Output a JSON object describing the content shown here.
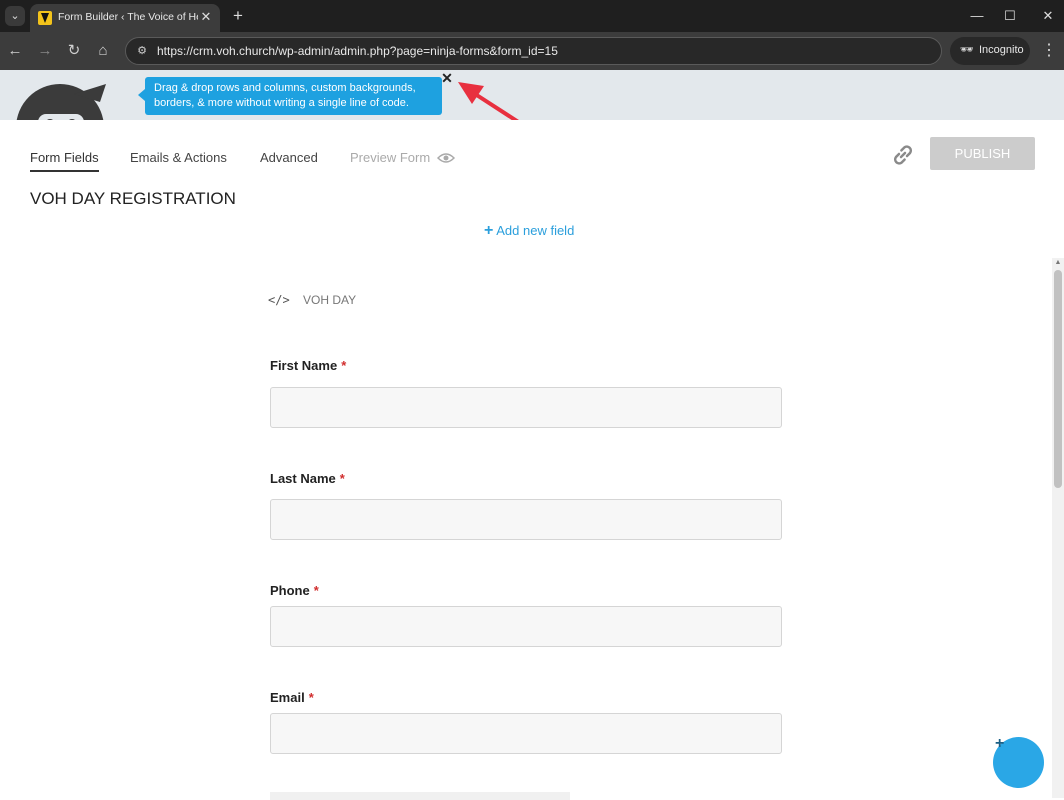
{
  "browser": {
    "tab_title": "Form Builder ‹ The Voice of Hea",
    "url": "https://crm.voh.church/wp-admin/admin.php?page=ninja-forms&form_id=15",
    "incognito_label": "Incognito",
    "icons": {
      "tab_search": "chevron-down-icon",
      "back": "back-arrow-icon",
      "forward": "forward-arrow-icon",
      "reload": "reload-icon",
      "home": "home-icon",
      "site_info": "site-info-icon",
      "incognito": "incognito-icon",
      "menu": "kebab-menu-icon"
    }
  },
  "banner": {
    "tooltip_text": "Drag & drop rows and columns, custom backgrounds, borders, & more without writing a single line of code.",
    "tooltip_close": "✕"
  },
  "builder": {
    "tabs": [
      {
        "label": "Form Fields",
        "active": true
      },
      {
        "label": "Emails & Actions",
        "active": false
      },
      {
        "label": "Advanced",
        "active": false
      },
      {
        "label": "Preview Form",
        "active": false,
        "disabled": true
      }
    ],
    "publish_label": "PUBLISH",
    "form_title": "VOH DAY REGISTRATION",
    "add_field_label": "Add new field",
    "add_field_plus": "+",
    "html_field_label": "VOH DAY",
    "fields": [
      {
        "label": "First Name",
        "required_mark": "*"
      },
      {
        "label": "Last Name",
        "required_mark": "*"
      },
      {
        "label": "Phone",
        "required_mark": "*"
      },
      {
        "label": "Email",
        "required_mark": "*"
      }
    ],
    "fab_icon": "+"
  },
  "colors": {
    "accent": "#2b9fdc",
    "tooltip": "#1ea1e0",
    "required": "#d12d2d",
    "arrow": "#e8303f",
    "publish_disabled": "#cccccc"
  }
}
